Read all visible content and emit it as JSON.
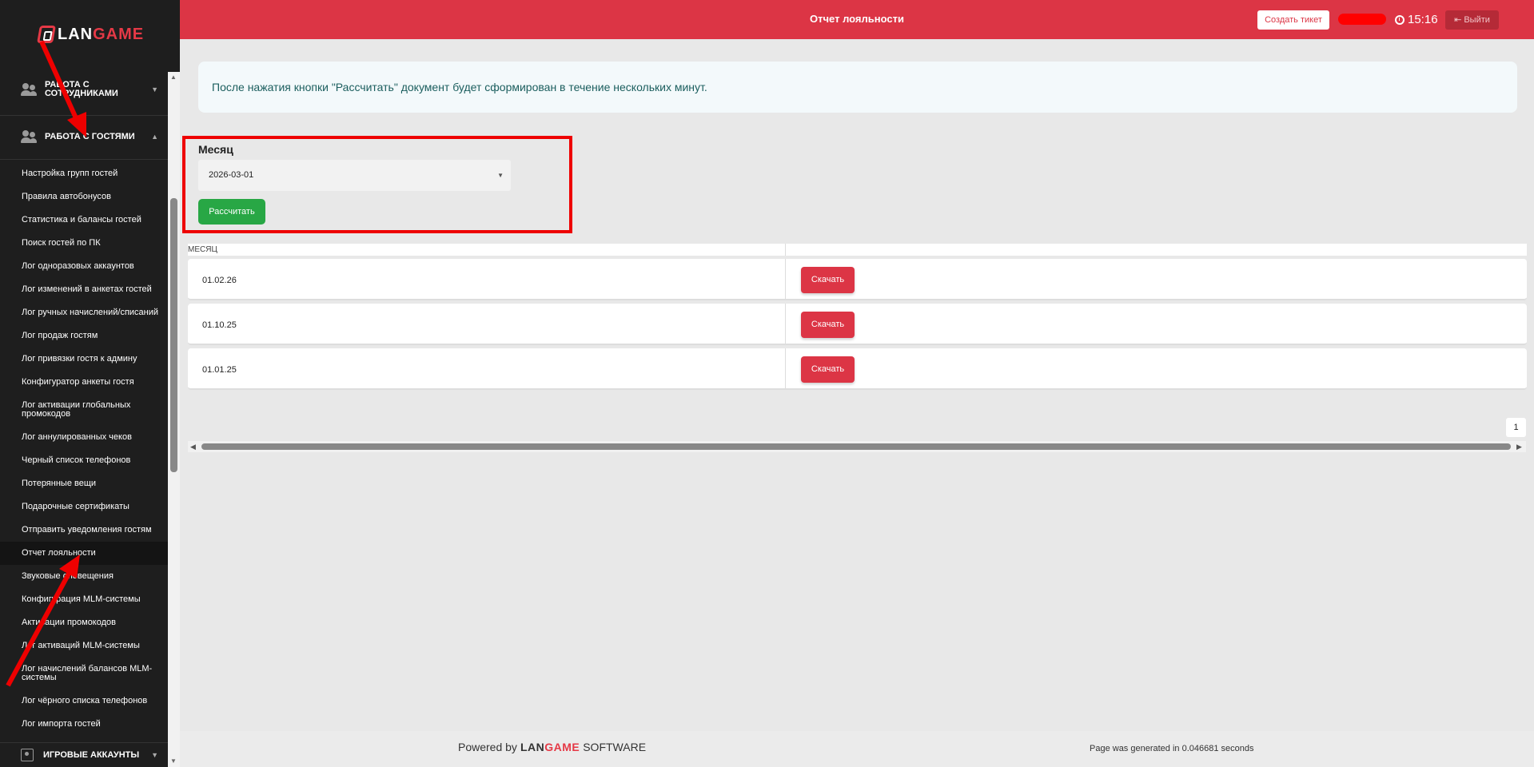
{
  "sidebar": {
    "logo": {
      "part1": "LAN",
      "part2": "GAME"
    },
    "groups": [
      {
        "label": "Работа с сотрудниками"
      },
      {
        "label": "Работа с гостями"
      }
    ],
    "items": [
      {
        "label": "Настройка групп гостей"
      },
      {
        "label": "Правила автобонусов"
      },
      {
        "label": "Статистика и балансы гостей"
      },
      {
        "label": "Поиск гостей по ПК"
      },
      {
        "label": "Лог одноразовых аккаунтов"
      },
      {
        "label": "Лог изменений в анкетах гостей"
      },
      {
        "label": "Лог ручных начислений/списаний"
      },
      {
        "label": "Лог продаж гостям"
      },
      {
        "label": "Лог привязки гостя к админу"
      },
      {
        "label": "Конфигуратор анкеты гостя"
      },
      {
        "label": "Лог активации глобальных промокодов"
      },
      {
        "label": "Лог аннулированных чеков"
      },
      {
        "label": "Черный список телефонов"
      },
      {
        "label": "Потерянные вещи"
      },
      {
        "label": "Подарочные сертификаты"
      },
      {
        "label": "Отправить уведомления гостям"
      },
      {
        "label": "Отчет лояльности"
      },
      {
        "label": "Звуковые оповещения"
      },
      {
        "label": "Конфигурация MLM-системы"
      },
      {
        "label": "Активации промокодов"
      },
      {
        "label": "Лог активаций MLM-системы"
      },
      {
        "label": "Лог начислений балансов MLM-системы"
      },
      {
        "label": "Лог чёрного списка телефонов"
      },
      {
        "label": "Лог импорта гостей"
      }
    ],
    "active_item": "Отчет лояльности",
    "bottom_group": {
      "label": "Игровые аккаунты"
    }
  },
  "header": {
    "title": "Отчет лояльности",
    "ticket_button": "Создать тикет",
    "time": "15:16",
    "logout_button": "Выйти",
    "brand_color": "#dc3545"
  },
  "alert": {
    "text": "После нажатия кнопки \"Рассчитать\" документ будет сформирован в течение нескольких минут."
  },
  "form": {
    "label": "Месяц",
    "month_value": "2026-03-01",
    "calculate_button": "Рассчитать"
  },
  "table": {
    "column_header": "МЕСЯЦ",
    "rows": [
      {
        "date": "01.02.26",
        "action": "Скачать"
      },
      {
        "date": "01.10.25",
        "action": "Скачать"
      },
      {
        "date": "01.01.25",
        "action": "Скачать"
      }
    ]
  },
  "pagination": {
    "current_page": "1"
  },
  "footer": {
    "powered_prefix": "Powered by",
    "brand_part1": "LAN",
    "brand_part2": "GAME",
    "brand_suffix": "SOFTWARE",
    "generated_text": "Page was generated in 0.046681 seconds"
  }
}
